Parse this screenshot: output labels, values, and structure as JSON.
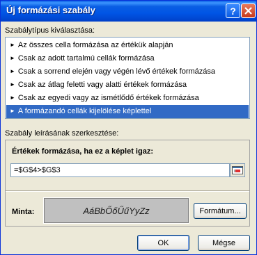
{
  "window": {
    "title": "Új formázási szabály",
    "help_button": "?",
    "close_button": "×"
  },
  "rule_type": {
    "label": "Szabálytípus kiválasztása:",
    "items": [
      "Az összes cella formázása az értékük alapján",
      "Csak az adott tartalmú cellák formázása",
      "Csak a sorrend elején vagy végén lévő értékek formázása",
      "Csak az átlag feletti vagy alatti értékek formázása",
      "Csak az egyedi vagy az ismétlődő értékek formázása",
      "A formázandó cellák kijelölése képlettel"
    ],
    "selected_index": 5
  },
  "description": {
    "label": "Szabály leírásának szerkesztése:",
    "heading": "Értékek formázása, ha ez a képlet igaz:",
    "formula_value": "=$G$4>$G$3",
    "sample_label": "Minta:",
    "sample_text": "AáBbŐőŰűYyZz",
    "format_button": "Formátum..."
  },
  "buttons": {
    "ok": "OK",
    "cancel": "Mégse"
  },
  "colors": {
    "selection": "#316ac5",
    "titlebar": "#0055e5",
    "sample_bg": "#c0c0c0"
  }
}
